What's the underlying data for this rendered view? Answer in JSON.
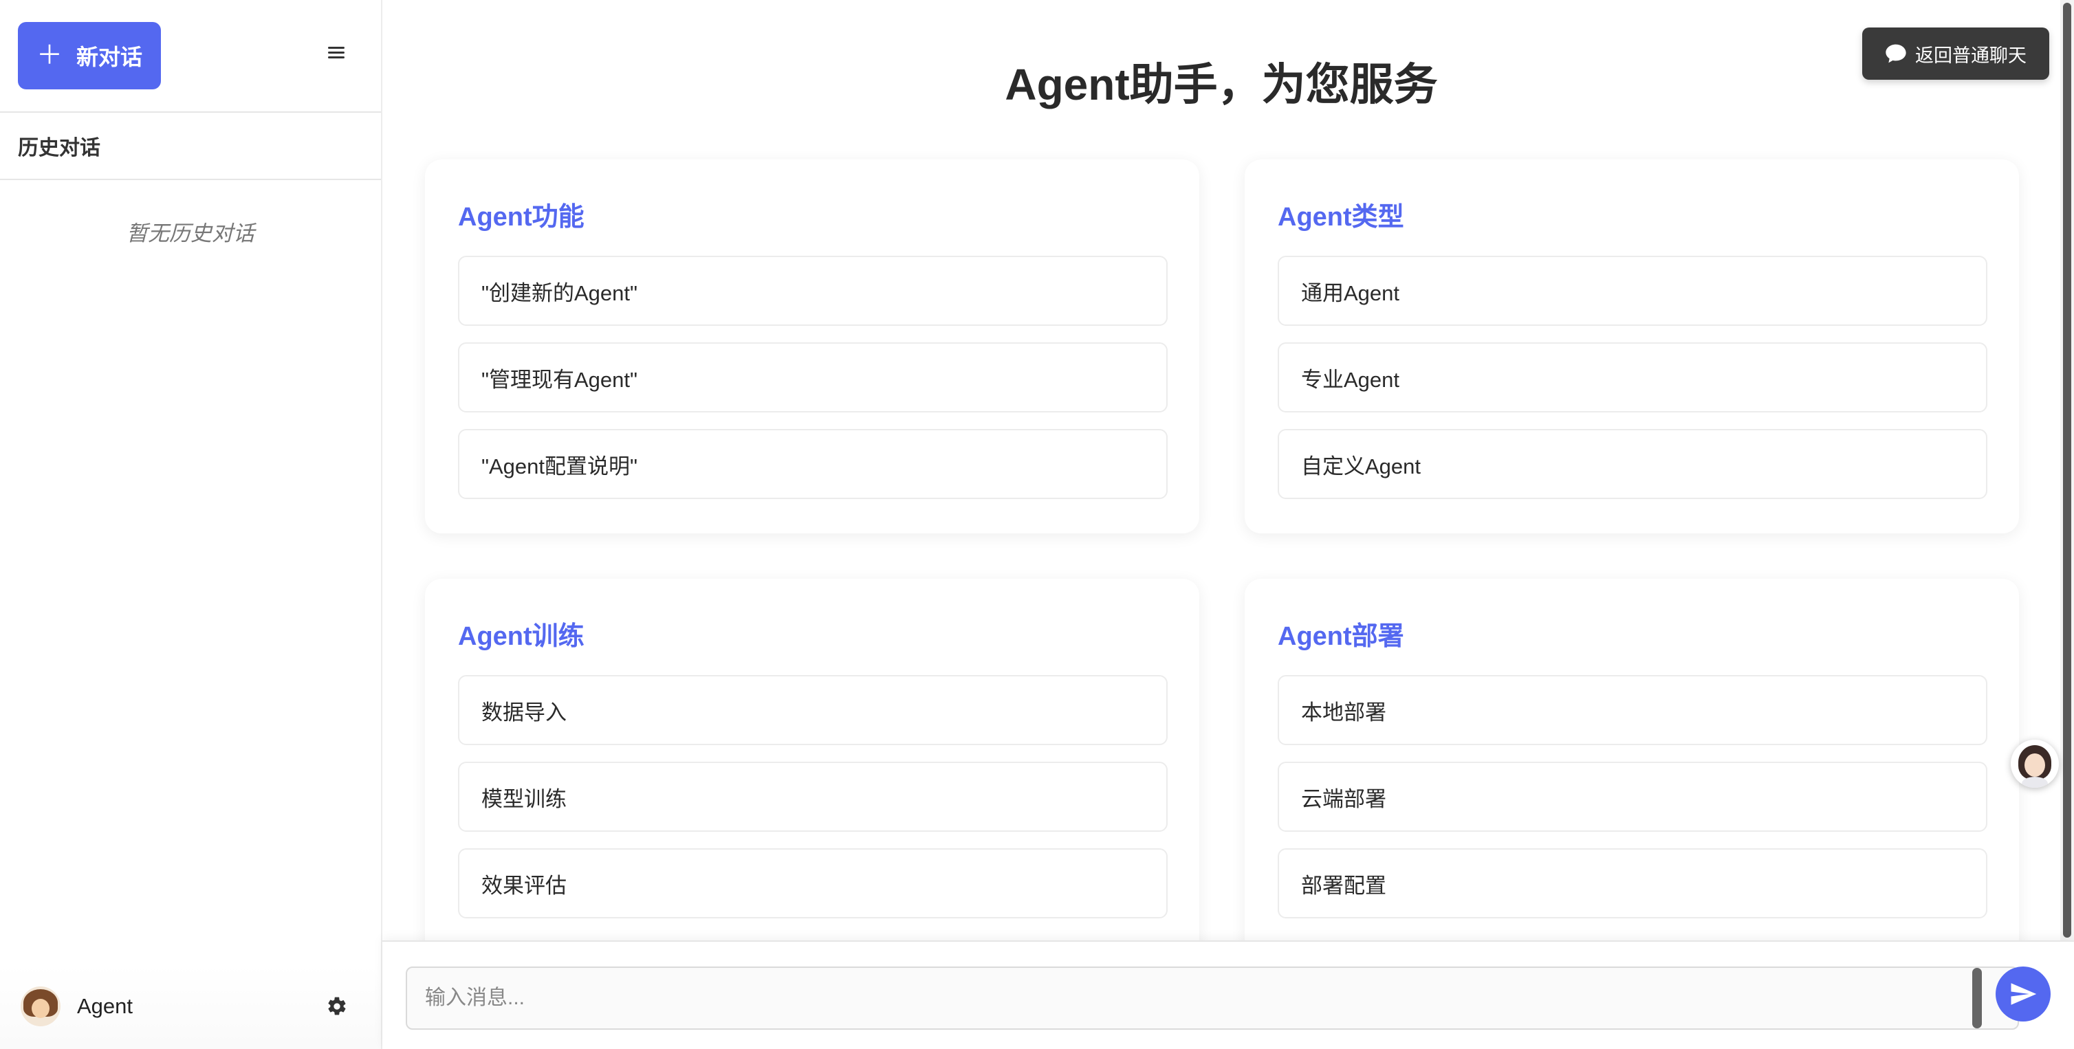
{
  "sidebar": {
    "new_chat_label": "新对话",
    "history_title": "历史对话",
    "empty_text": "暂无历史对话",
    "user_name": "Agent"
  },
  "main": {
    "title": "Agent助手，为您服务",
    "back_button_label": "返回普通聊天",
    "cards": [
      {
        "title": "Agent功能",
        "items": [
          "\"创建新的Agent\"",
          "\"管理现有Agent\"",
          "\"Agent配置说明\""
        ]
      },
      {
        "title": "Agent类型",
        "items": [
          "通用Agent",
          "专业Agent",
          "自定义Agent"
        ]
      },
      {
        "title": "Agent训练",
        "items": [
          "数据导入",
          "模型训练",
          "效果评估"
        ]
      },
      {
        "title": "Agent部署",
        "items": [
          "本地部署",
          "云端部署",
          "部署配置"
        ]
      }
    ]
  },
  "input": {
    "placeholder": "输入消息...",
    "value": ""
  },
  "colors": {
    "accent": "#5468f0",
    "dark_button": "#3a3a3a"
  },
  "icons": [
    "plus-icon",
    "menu-icon",
    "gear-icon",
    "chat-bubble-icon",
    "send-icon",
    "avatar"
  ]
}
